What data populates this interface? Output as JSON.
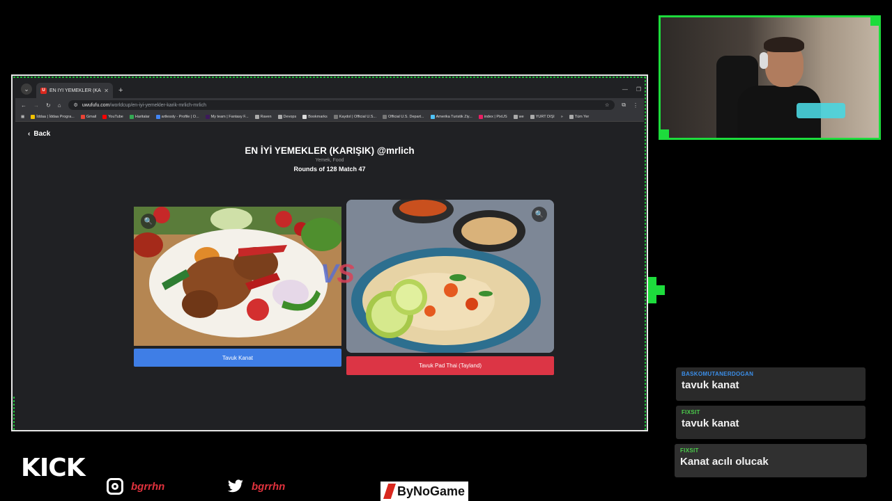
{
  "browser": {
    "tab_title": "EN İYİ YEMEKLER (KARIŞIK) @m",
    "tab_favicon": "U",
    "url_host": "uwufufu.com",
    "url_path": "/worldcup/en-iyi-yemekler-karik-mrlich-mrlich",
    "bookmarks": [
      "İddaa | İddaa Progra...",
      "Gmail",
      "YouTube",
      "Haritalar",
      "artlessly - Profile | O...",
      "My team | Fantasy F...",
      "Raven",
      "Devops",
      "Bookmarks",
      "Kaydol | Official U.S...",
      "Official U.S. Depart...",
      "Amerika Turistik Ziy...",
      "index | PixUS",
      "we",
      "YURT DIŞI"
    ],
    "bookmarks_more": "Tüm Yer"
  },
  "page": {
    "back_label": "Back",
    "title": "EN İYİ YEMEKLER (KARIŞIK) @mrlich",
    "categories": "Yemek, Food",
    "round_info": "Rounds of 128 Match 47",
    "vs_v": "V",
    "vs_s": "S",
    "left_choice": "Tavuk Kanat",
    "right_choice": "Tavuk Pad Thai (Tayland)"
  },
  "chat": [
    {
      "user": "BASKOMUTANERDOGAN",
      "text": "tavuk kanat",
      "color": "#3b8ee8"
    },
    {
      "user": "FIXSIT",
      "text": "tavuk kanat",
      "color": "#4ccf4c"
    },
    {
      "user": "FIXSIT",
      "text": "Kanat acılı olucak",
      "color": "#4ccf4c"
    }
  ],
  "branding": {
    "platform": "KICK",
    "instagram_handle": "bgrrhn",
    "twitter_handle": "bgrrhn",
    "sponsor": "ByNoGame"
  },
  "colors": {
    "accent": "#1ddc3c",
    "left_button": "#3f7ee6",
    "right_button": "#dc3545"
  }
}
